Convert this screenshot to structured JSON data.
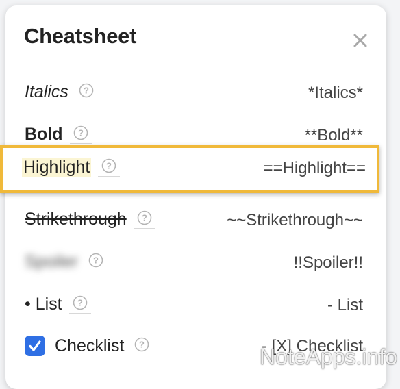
{
  "panel": {
    "title": "Cheatsheet",
    "close_icon": "close-icon"
  },
  "rows": [
    {
      "label": "Italics",
      "syntax": "*Italics*",
      "style": "italic"
    },
    {
      "label": "Bold",
      "syntax": "**Bold**",
      "style": "bold"
    },
    {
      "label": "Highlight",
      "syntax": "==Highlight==",
      "style": "highlight"
    },
    {
      "label": "Strikethrough",
      "syntax": "~~Strikethrough~~",
      "style": "strikethrough"
    },
    {
      "label": "Spoiler",
      "syntax": "!!Spoiler!!",
      "style": "spoiler-blurred"
    },
    {
      "label": "• List",
      "syntax": "- List",
      "style": "list"
    },
    {
      "label": "Checklist",
      "syntax": "- [X] Checklist",
      "style": "checklist"
    }
  ],
  "colors": {
    "highlight_border": "#f0b93a",
    "highlight_fill": "#fbf5d3",
    "checkbox": "#2f6fe4"
  },
  "watermark": "NoteApps.info"
}
